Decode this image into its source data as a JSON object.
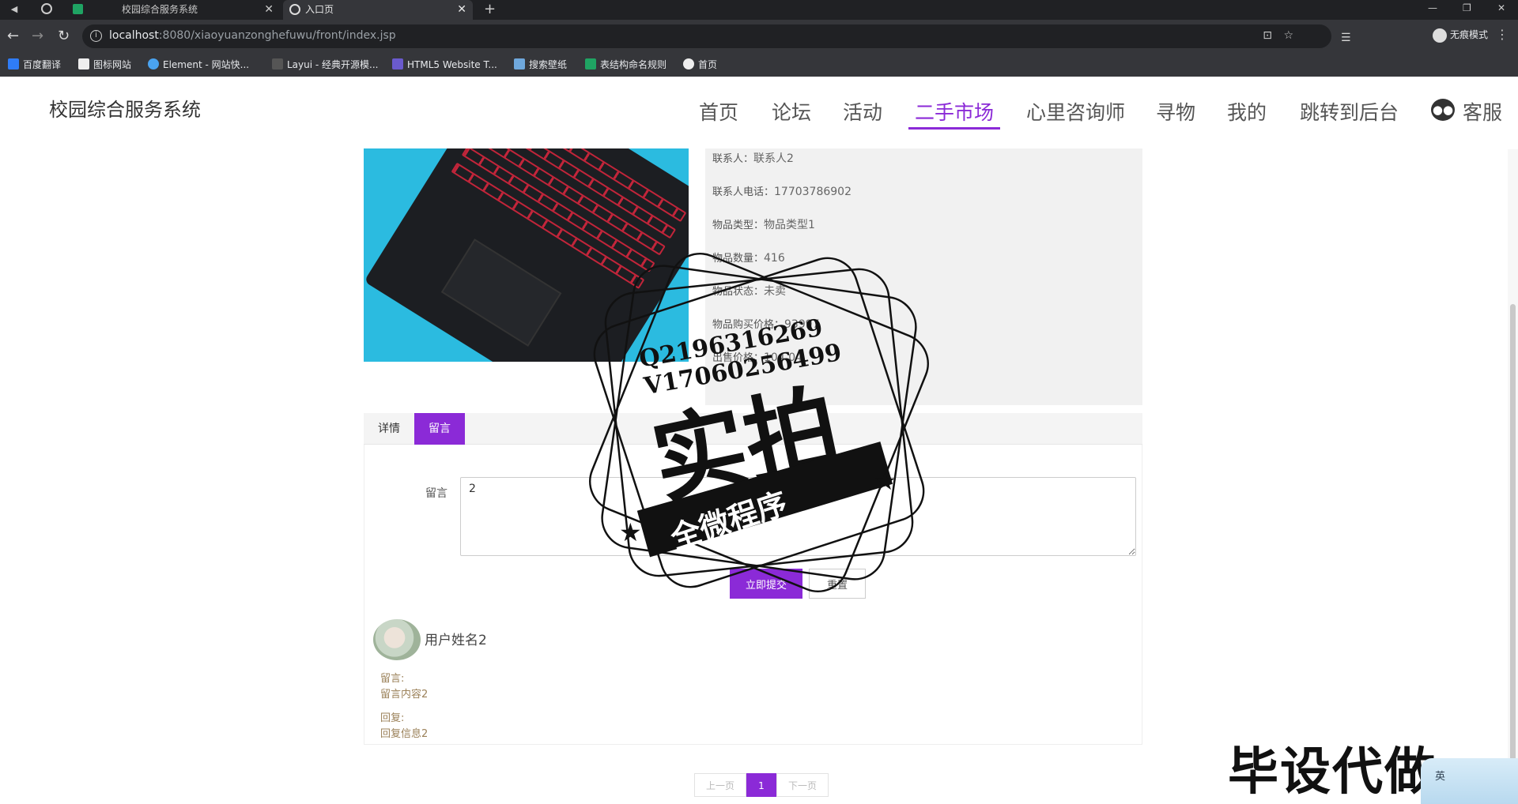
{
  "browser": {
    "tabs": [
      {
        "title": "校园综合服务系统",
        "active": false
      },
      {
        "title": "入口页",
        "active": true
      }
    ],
    "url_host": "localhost",
    "url_rest": ":8080/xiaoyuanzonghefuwu/front/index.jsp",
    "incognito_label": "无痕模式",
    "bookmarks": [
      "百度翻译",
      "图标网站",
      "Element - 网站快...",
      "Layui - 经典开源模...",
      "HTML5 Website T...",
      "搜索壁纸",
      "表结构命名规则",
      "首页"
    ]
  },
  "site": {
    "logo": "校园综合服务系统",
    "nav": [
      "首页",
      "论坛",
      "活动",
      "二手市场",
      "心里咨询师",
      "寻物",
      "我的",
      "跳转到后台"
    ],
    "active_nav": "二手市场",
    "kefu": "客服"
  },
  "detail": {
    "rows": [
      {
        "label": "联系人：",
        "value": "联系人2"
      },
      {
        "label": "联系人电话：",
        "value": "17703786902"
      },
      {
        "label": "物品类型：",
        "value": "物品类型1"
      },
      {
        "label": "物品数量：",
        "value": "416"
      },
      {
        "label": "物品状态：",
        "value": "未卖"
      },
      {
        "label": "物品购买价格：",
        "value": "93997"
      },
      {
        "label": "出售价格：",
        "value": "104.04"
      }
    ]
  },
  "tabs": {
    "detail": "详情",
    "comment": "留言",
    "active": "留言"
  },
  "form": {
    "label": "留言",
    "value": "2",
    "submit": "立即提交",
    "reset": "重置"
  },
  "comment": {
    "user": "用户姓名2",
    "msg_label": "留言:",
    "msg": "留言内容2",
    "reply_label": "回复:",
    "reply": "回复信息2"
  },
  "pager": {
    "prev": "上一页",
    "current": "1",
    "next": "下一页"
  },
  "watermarks": {
    "qq": "Q2196316269",
    "v": "V17060256499",
    "big": "实拍",
    "ribbon": "全微程序",
    "corner": "毕设代做",
    "ime": "英"
  },
  "colors": {
    "accent": "#8b2ad7",
    "chrome_dark": "#202124",
    "chrome": "#35363a"
  }
}
